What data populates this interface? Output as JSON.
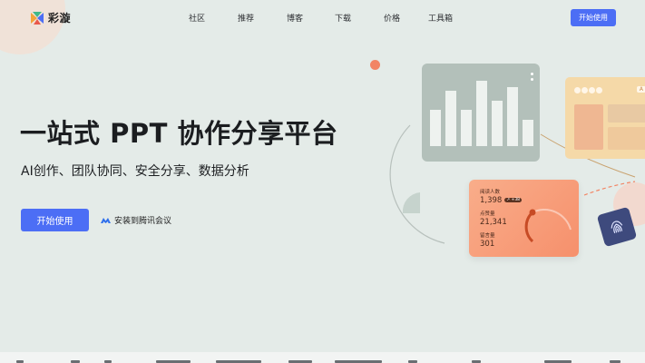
{
  "brand": {
    "name": "彩漩"
  },
  "nav": {
    "items": [
      {
        "label": "社区"
      },
      {
        "label": "推荐"
      },
      {
        "label": "博客"
      },
      {
        "label": "下载"
      },
      {
        "label": "价格"
      },
      {
        "label": "工具箱"
      }
    ],
    "cta_label": "开始使用"
  },
  "hero": {
    "title": "一站式 PPT 协作分享平台",
    "subtitle": "AI创作、团队协同、安全分享、数据分析",
    "cta_label": "开始使用",
    "install_label": "安装到腾讯会议"
  },
  "stats_card": {
    "reads_label": "阅读人数",
    "reads_value": "1,398",
    "reads_badge": "↗ +38",
    "likes_label": "点赞量",
    "likes_value": "21,341",
    "comments_label": "留言量",
    "comments_value": "301"
  },
  "bar_card": {
    "bar_levels": [
      0.55,
      0.85,
      0.55,
      1.0,
      0.7,
      0.9,
      0.4
    ]
  },
  "colors": {
    "accent": "#4c6ef5",
    "background": "#e4ebe8",
    "stats_card": "#f7996f",
    "gray_card": "#b3c0ba",
    "yellow_card": "#f5d9a8",
    "finger_card": "#3e4a7d"
  }
}
